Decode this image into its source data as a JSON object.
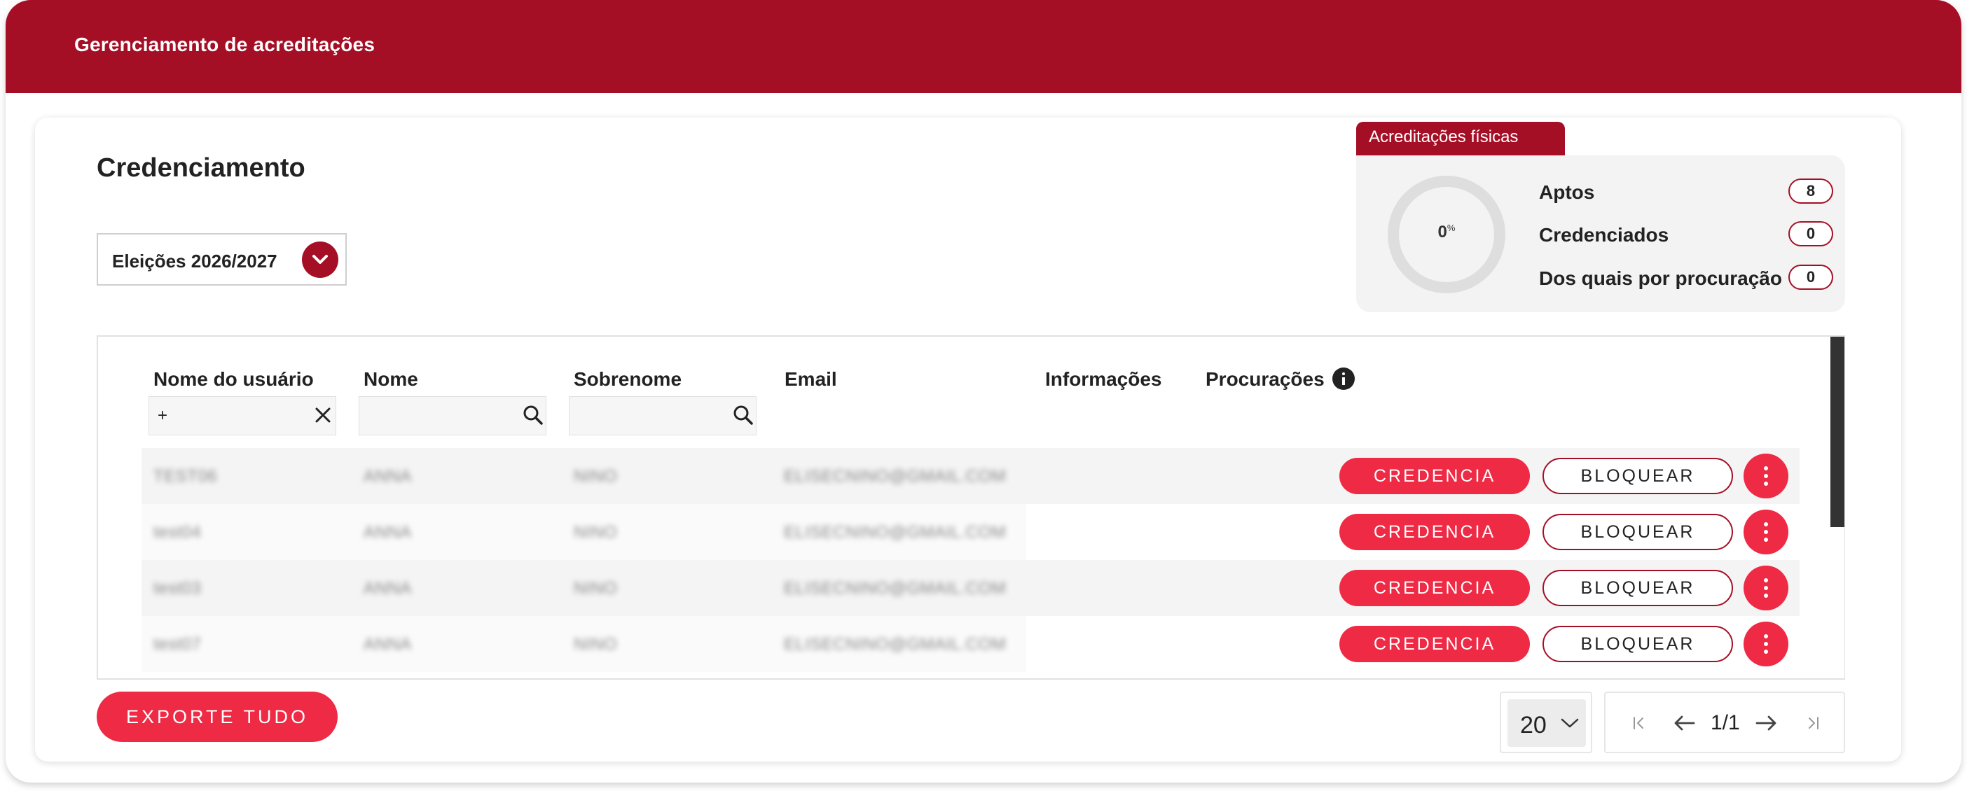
{
  "app": {
    "title": "Gerenciamento de acreditações"
  },
  "page": {
    "title": "Credenciamento"
  },
  "election_select": {
    "value": "Eleições 2026/2027"
  },
  "stats": {
    "tab_label": "Acreditações físicas",
    "percent": "0",
    "percent_suffix": "%",
    "rows": [
      {
        "label": "Aptos",
        "count": "8"
      },
      {
        "label": "Credenciados",
        "count": "0"
      },
      {
        "label": "Dos quais por procuração",
        "count": "0"
      }
    ],
    "accent_color": "#a50f26"
  },
  "table": {
    "columns": {
      "username": "Nome do usuário",
      "name": "Nome",
      "surname": "Sobrenome",
      "email": "Email",
      "info": "Informações",
      "proxies": "Procurações"
    },
    "filters": {
      "username_value": "+",
      "name_value": "",
      "surname_value": ""
    },
    "rows": [
      {
        "username": "TEST06",
        "name": "ANNA",
        "surname": "NINO",
        "email": "ELISECNINO@GMAIL.COM",
        "credit_label": "CREDENCIA",
        "block_label": "BLOQUEAR"
      },
      {
        "username": "test04",
        "name": "ANNA",
        "surname": "NINO",
        "email": "ELISECNINO@GMAIL.COM",
        "credit_label": "CREDENCIA",
        "block_label": "BLOQUEAR"
      },
      {
        "username": "test03",
        "name": "ANNA",
        "surname": "NINO",
        "email": "ELISECNINO@GMAIL.COM",
        "credit_label": "CREDENCIA",
        "block_label": "BLOQUEAR"
      },
      {
        "username": "test07",
        "name": "ANNA",
        "surname": "NINO",
        "email": "ELISECNINO@GMAIL.COM",
        "credit_label": "CREDENCIA",
        "block_label": "BLOQUEAR"
      }
    ]
  },
  "footer": {
    "export_label": "EXPORTE TUDO",
    "page_size": "20",
    "pagination": "1/1"
  },
  "colors": {
    "header": "#a50f26",
    "primary_button": "#ee2a45"
  }
}
